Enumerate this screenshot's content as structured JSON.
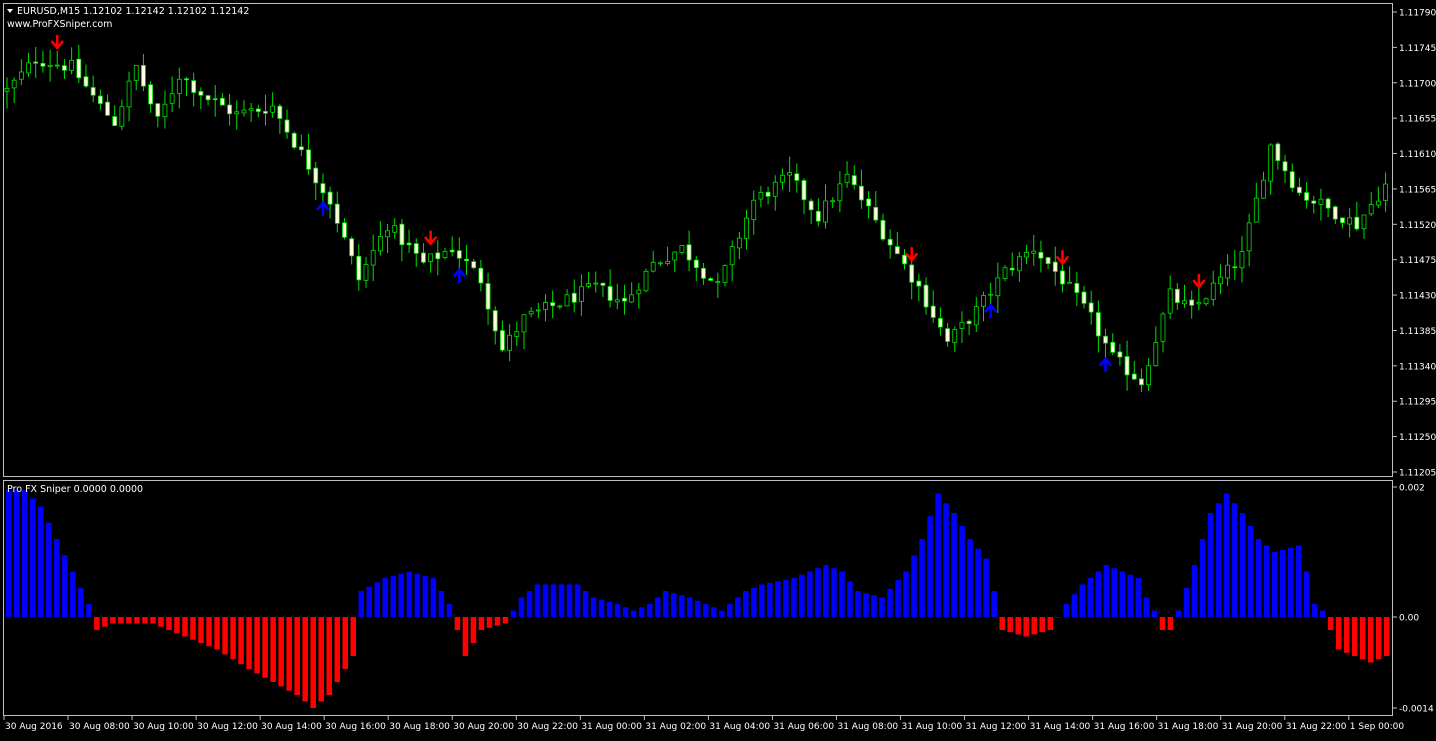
{
  "header": {
    "symbol_line": "EURUSD,M15  1.12102 1.12142 1.12102 1.12142",
    "website": "www.ProFXSniper.com"
  },
  "indicator": {
    "label": "Pro FX Sniper 0.0000 0.0000"
  },
  "colors": {
    "background": "#000000",
    "frame": "#c0c0c0",
    "candle_wick": "#00e000",
    "candle_bull_body": "#000000",
    "candle_bull_border": "#00e000",
    "candle_bear_body": "#ffffe0",
    "candle_bear_border": "#00e000",
    "sell_arrow": "#ff0000",
    "buy_arrow": "#0000ff",
    "hist_positive": "#0000ff",
    "hist_negative": "#ff0000",
    "text": "#ffffff"
  },
  "chart_data": [
    {
      "type": "candlestick",
      "title": "EURUSD,M15  1.12102 1.12142 1.12102 1.12142",
      "ylim": [
        1.11205,
        1.1179
      ],
      "y_ticks": [
        "1.11790",
        "1.11745",
        "1.11700",
        "1.11655",
        "1.11610",
        "1.11565",
        "1.11520",
        "1.11475",
        "1.11430",
        "1.11385",
        "1.11340",
        "1.11295",
        "1.11250",
        "1.11205"
      ],
      "x_ticks": [
        "30 Aug 2016",
        "30 Aug 08:00",
        "30 Aug 10:00",
        "30 Aug 12:00",
        "30 Aug 14:00",
        "30 Aug 16:00",
        "30 Aug 18:00",
        "30 Aug 20:00",
        "30 Aug 22:00",
        "31 Aug 00:00",
        "31 Aug 02:00",
        "31 Aug 04:00",
        "31 Aug 06:00",
        "31 Aug 08:00",
        "31 Aug 10:00",
        "31 Aug 12:00",
        "31 Aug 14:00",
        "31 Aug 16:00",
        "31 Aug 18:00",
        "31 Aug 20:00",
        "31 Aug 22:00",
        "1 Sep 00:00"
      ],
      "close_path": [
        [
          0,
          1.1169
        ],
        [
          4,
          1.1173
        ],
        [
          9,
          1.1172
        ],
        [
          13,
          1.1167
        ],
        [
          15,
          1.1165
        ],
        [
          18,
          1.1172
        ],
        [
          21,
          1.1165
        ],
        [
          24,
          1.1171
        ],
        [
          28,
          1.1168
        ],
        [
          32,
          1.1166
        ],
        [
          37,
          1.1167
        ],
        [
          41,
          1.1161
        ],
        [
          45,
          1.1155
        ],
        [
          49,
          1.1145
        ],
        [
          53,
          1.1152
        ],
        [
          58,
          1.1147
        ],
        [
          62,
          1.1149
        ],
        [
          66,
          1.1145
        ],
        [
          69,
          1.1136
        ],
        [
          72,
          1.114
        ],
        [
          77,
          1.1142
        ],
        [
          82,
          1.1144
        ],
        [
          86,
          1.1142
        ],
        [
          90,
          1.1147
        ],
        [
          94,
          1.1149
        ],
        [
          99,
          1.1144
        ],
        [
          104,
          1.1155
        ],
        [
          109,
          1.1158
        ],
        [
          113,
          1.1153
        ],
        [
          117,
          1.1158
        ],
        [
          122,
          1.1151
        ],
        [
          127,
          1.1144
        ],
        [
          131,
          1.1137
        ],
        [
          135,
          1.1141
        ],
        [
          139,
          1.1146
        ],
        [
          143,
          1.1149
        ],
        [
          147,
          1.1145
        ],
        [
          151,
          1.114
        ],
        [
          154,
          1.1135
        ],
        [
          158,
          1.1132
        ],
        [
          162,
          1.1143
        ],
        [
          165,
          1.1141
        ],
        [
          169,
          1.1145
        ],
        [
          172,
          1.1148
        ],
        [
          176,
          1.1162
        ],
        [
          180,
          1.1156
        ],
        [
          184,
          1.1154
        ],
        [
          188,
          1.1152
        ],
        [
          192,
          1.1157
        ]
      ],
      "sell_arrows": [
        "30 Aug 06:45",
        "30 Aug 19:45",
        "31 Aug 12:30",
        "31 Aug 17:45",
        "31 Aug 22:30"
      ],
      "buy_arrows": [
        "30 Aug 16:00",
        "30 Aug 20:45",
        "31 Aug 15:15",
        "31 Aug 19:15"
      ]
    },
    {
      "type": "bar",
      "title": "Pro FX Sniper 0.0000 0.0000",
      "ylim": [
        -0.0014,
        0.002
      ],
      "y_ticks": [
        "0.002",
        "0.00",
        "-0.0014"
      ],
      "value_path": [
        [
          0,
          0.00195
        ],
        [
          2,
          0.00195
        ],
        [
          4,
          0.0017
        ],
        [
          6,
          0.0012
        ],
        [
          8,
          0.0007
        ],
        [
          10,
          0.0002
        ],
        [
          11,
          -0.0002
        ],
        [
          13,
          -0.0001
        ],
        [
          18,
          -0.0001
        ],
        [
          22,
          -0.0003
        ],
        [
          26,
          -0.0005
        ],
        [
          30,
          -0.0008
        ],
        [
          33,
          -0.001
        ],
        [
          36,
          -0.0012
        ],
        [
          38,
          -0.0014
        ],
        [
          40,
          -0.0012
        ],
        [
          43,
          -0.0006
        ],
        [
          44,
          0.0004
        ],
        [
          47,
          0.0006
        ],
        [
          50,
          0.0007
        ],
        [
          53,
          0.0006
        ],
        [
          55,
          0.0002
        ],
        [
          56,
          -0.0002
        ],
        [
          57,
          -0.0006
        ],
        [
          59,
          -0.0002
        ],
        [
          62,
          -0.0001
        ],
        [
          63,
          0.0001
        ],
        [
          64,
          0.0003
        ],
        [
          66,
          0.0005
        ],
        [
          71,
          0.0005
        ],
        [
          73,
          0.0003
        ],
        [
          76,
          0.0002
        ],
        [
          78,
          0.0001
        ],
        [
          80,
          0.0002
        ],
        [
          82,
          0.0004
        ],
        [
          85,
          0.0003
        ],
        [
          87,
          0.0002
        ],
        [
          89,
          0.0001
        ],
        [
          92,
          0.0004
        ],
        [
          94,
          0.0005
        ],
        [
          98,
          0.0006
        ],
        [
          102,
          0.0008
        ],
        [
          104,
          0.0007
        ],
        [
          106,
          0.0004
        ],
        [
          109,
          0.0003
        ],
        [
          112,
          0.0007
        ],
        [
          114,
          0.0012
        ],
        [
          116,
          0.0019
        ],
        [
          118,
          0.0016
        ],
        [
          120,
          0.0012
        ],
        [
          122,
          0.0009
        ],
        [
          123,
          0.0004
        ],
        [
          124,
          -0.0002
        ],
        [
          127,
          -0.0003
        ],
        [
          130,
          -0.0002
        ],
        [
          132,
          0.0002
        ],
        [
          134,
          0.0005
        ],
        [
          137,
          0.0008
        ],
        [
          139,
          0.0007
        ],
        [
          141,
          0.0006
        ],
        [
          142,
          0.0003
        ],
        [
          143,
          0.0001
        ],
        [
          144,
          -0.0002
        ],
        [
          145,
          -0.0002
        ],
        [
          146,
          0.0001
        ],
        [
          148,
          0.0008
        ],
        [
          150,
          0.0016
        ],
        [
          152,
          0.0019
        ],
        [
          154,
          0.0016
        ],
        [
          156,
          0.0012
        ],
        [
          158,
          0.001
        ],
        [
          161,
          0.0011
        ],
        [
          162,
          0.0007
        ],
        [
          163,
          0.0002
        ],
        [
          164,
          0.0001
        ],
        [
          165,
          -0.0002
        ],
        [
          166,
          -0.0005
        ],
        [
          168,
          -0.0006
        ],
        [
          170,
          -0.0007
        ],
        [
          172,
          -0.0006
        ]
      ]
    }
  ]
}
